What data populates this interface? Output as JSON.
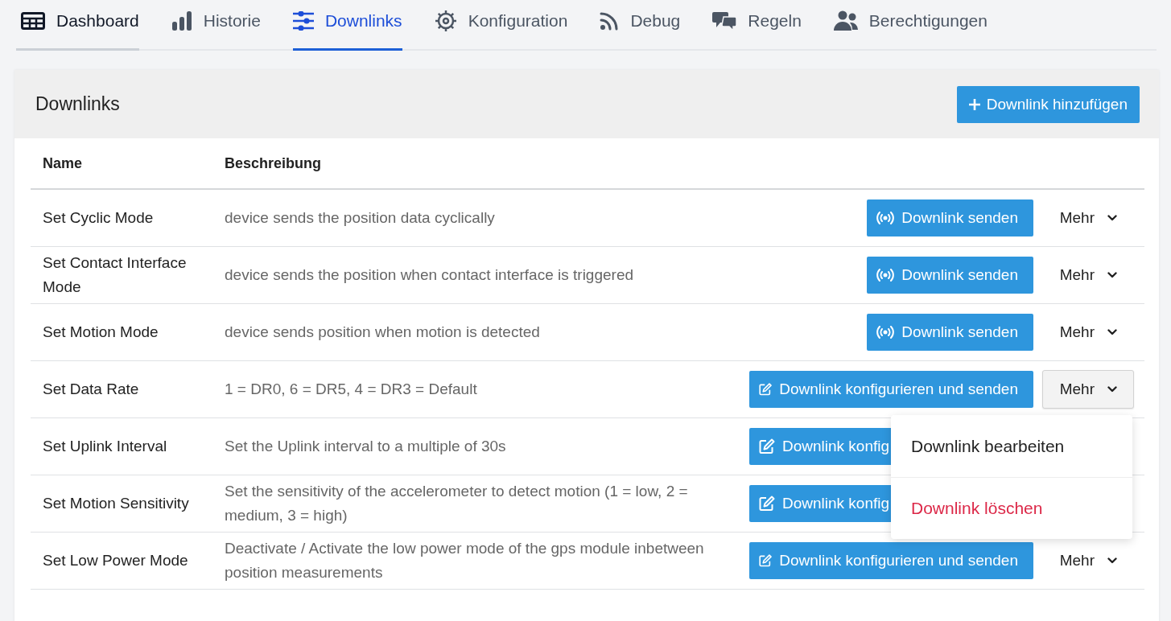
{
  "tabs": [
    {
      "label": "Dashboard",
      "selected": false,
      "hovered": true
    },
    {
      "label": "Historie",
      "selected": false,
      "hovered": false
    },
    {
      "label": "Downlinks",
      "selected": true,
      "hovered": false
    },
    {
      "label": "Konfiguration",
      "selected": false,
      "hovered": false
    },
    {
      "label": "Debug",
      "selected": false,
      "hovered": false
    },
    {
      "label": "Regeln",
      "selected": false,
      "hovered": false
    },
    {
      "label": "Berechtigungen",
      "selected": false,
      "hovered": false
    }
  ],
  "card": {
    "title": "Downlinks",
    "add_button": "Downlink hinzufügen"
  },
  "table": {
    "columns": [
      "Name",
      "Beschreibung"
    ],
    "rows": [
      {
        "name": "Set Cyclic Mode",
        "description": "device sends the position data cyclically",
        "action": {
          "kind": "send",
          "label": "Downlink senden"
        },
        "more": "Mehr",
        "menu_open": false
      },
      {
        "name": "Set Contact Interface Mode",
        "description": "device sends the position when contact interface is triggered",
        "action": {
          "kind": "send",
          "label": "Downlink senden"
        },
        "more": "Mehr",
        "menu_open": false
      },
      {
        "name": "Set Motion Mode",
        "description": "device sends position when motion is detected",
        "action": {
          "kind": "send",
          "label": "Downlink senden"
        },
        "more": "Mehr",
        "menu_open": false
      },
      {
        "name": "Set Data Rate",
        "description": "1 = DR0, 6 = DR5, 4 = DR3 = Default",
        "action": {
          "kind": "configure",
          "label": "Downlink konfigurieren und senden"
        },
        "more": "Mehr",
        "menu_open": true,
        "menu": [
          {
            "kind": "default",
            "label": "Downlink bearbeiten"
          },
          {
            "kind": "danger",
            "label": "Downlink löschen"
          }
        ]
      },
      {
        "name": "Set Uplink Interval",
        "description": "Set the Uplink interval to a multiple of 30s",
        "action": {
          "kind": "configure",
          "label": "Downlink konfig"
        }
      },
      {
        "name": "Set Motion Sensitivity",
        "description": "Set the sensitivity of the accelerometer to detect motion (1 = low, 2 = medium, 3 = high)",
        "action": {
          "kind": "configure",
          "label": "Downlink konfig"
        }
      },
      {
        "name": "Set Low Power Mode",
        "description": "Deactivate / Activate the low power mode of the gps module inbetween position measurements",
        "action": {
          "kind": "configure",
          "label": "Downlink konfigurieren und senden"
        },
        "more": "Mehr",
        "menu_open": false
      }
    ]
  }
}
